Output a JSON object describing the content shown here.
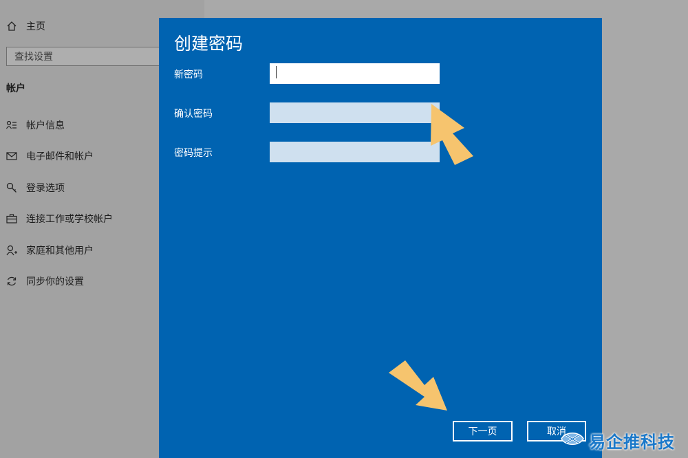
{
  "sidebar": {
    "home_label": "主页",
    "search_placeholder": "查找设置",
    "section_title": "帐户",
    "items": [
      {
        "label": "帐户信息",
        "icon": "account-info-icon"
      },
      {
        "label": "电子邮件和帐户",
        "icon": "mail-icon"
      },
      {
        "label": "登录选项",
        "icon": "key-icon"
      },
      {
        "label": "连接工作或学校帐户",
        "icon": "briefcase-icon"
      },
      {
        "label": "家庭和其他用户",
        "icon": "person-add-icon"
      },
      {
        "label": "同步你的设置",
        "icon": "sync-icon"
      }
    ]
  },
  "dialog": {
    "title": "创建密码",
    "fields": [
      {
        "label": "新密码",
        "value": ""
      },
      {
        "label": "确认密码",
        "value": ""
      },
      {
        "label": "密码提示",
        "value": ""
      }
    ],
    "next_label": "下一页",
    "cancel_label": "取消"
  },
  "watermark": {
    "text": "易企推科技"
  },
  "colors": {
    "dialog_blue": "#0063b1",
    "arrow_yellow": "#f6c46e",
    "watermark_blue": "#1a78c9"
  }
}
